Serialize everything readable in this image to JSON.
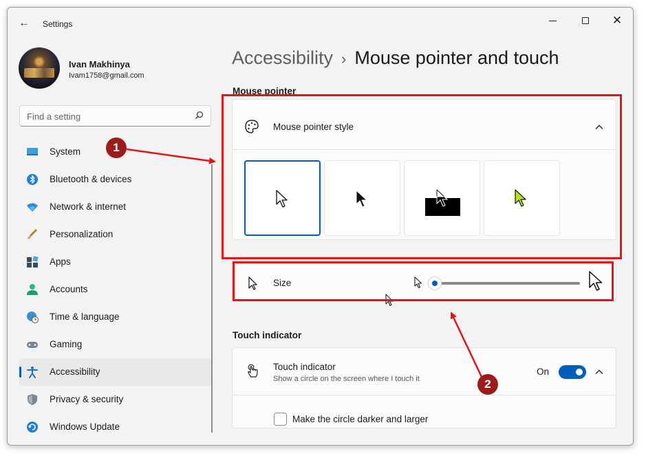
{
  "window": {
    "app_title": "Settings",
    "controls": {
      "minimize": "minimize",
      "maximize": "maximize",
      "close": "✕"
    }
  },
  "profile": {
    "name": "Ivan Makhinya",
    "email": "Ivam1758@gmail.com"
  },
  "search": {
    "placeholder": "Find a setting",
    "icon": "search-icon"
  },
  "sidebar": {
    "items": [
      {
        "label": "System",
        "icon": "system-icon",
        "active": false
      },
      {
        "label": "Bluetooth & devices",
        "icon": "bluetooth-icon",
        "active": false
      },
      {
        "label": "Network & internet",
        "icon": "wifi-icon",
        "active": false
      },
      {
        "label": "Personalization",
        "icon": "brush-icon",
        "active": false
      },
      {
        "label": "Apps",
        "icon": "apps-icon",
        "active": false
      },
      {
        "label": "Accounts",
        "icon": "accounts-icon",
        "active": false
      },
      {
        "label": "Time & language",
        "icon": "time-language-icon",
        "active": false
      },
      {
        "label": "Gaming",
        "icon": "gaming-icon",
        "active": false
      },
      {
        "label": "Accessibility",
        "icon": "accessibility-icon",
        "active": true
      },
      {
        "label": "Privacy & security",
        "icon": "shield-icon",
        "active": false
      },
      {
        "label": "Windows Update",
        "icon": "windows-update-icon",
        "active": false
      }
    ]
  },
  "breadcrumb": {
    "parent": "Accessibility",
    "separator": "›",
    "current": "Mouse pointer and touch"
  },
  "mouse_pointer": {
    "section_title": "Mouse pointer",
    "style_label": "Mouse pointer style",
    "styles": [
      "white",
      "black",
      "inverted",
      "custom"
    ],
    "selected_style": "white",
    "size_label": "Size",
    "size_value": 0
  },
  "touch_indicator": {
    "section_title": "Touch indicator",
    "label": "Touch indicator",
    "description": "Show a circle on the screen where I touch it",
    "toggle_text": "On",
    "enabled": true,
    "option_label": "Make the circle darker and larger",
    "option_checked": false
  },
  "annotations": {
    "badge_1": "1",
    "badge_2": "2",
    "color": "#e01515",
    "badge_color": "#9c1c1c"
  },
  "colors": {
    "accent": "#005fb8",
    "custom_pointer": "#b5e61d"
  }
}
